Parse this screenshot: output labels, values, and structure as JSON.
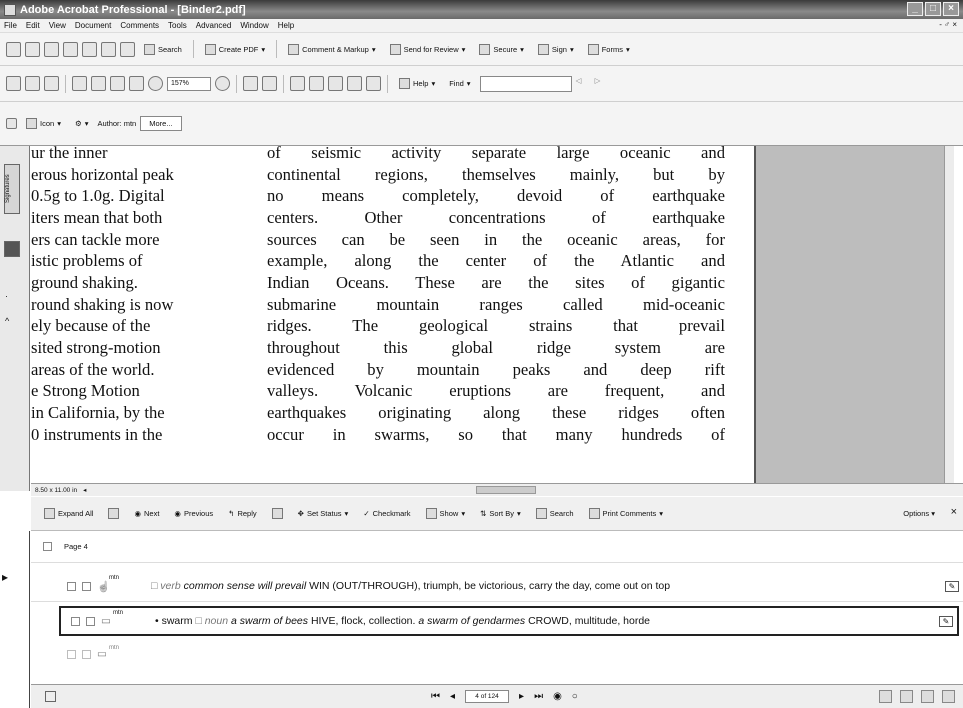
{
  "window": {
    "title": "Adobe Acrobat Professional - [Binder2.pdf]"
  },
  "menu": [
    "File",
    "Edit",
    "View",
    "Document",
    "Comments",
    "Tools",
    "Advanced",
    "Window",
    "Help"
  ],
  "toolbar1": {
    "search": "Search",
    "create_pdf": "Create PDF",
    "comment_markup": "Comment & Markup",
    "send_review": "Send for Review",
    "secure": "Secure",
    "sign": "Sign",
    "forms": "Forms"
  },
  "toolbar2": {
    "zoom": "157%",
    "help": "Help",
    "find": "Find"
  },
  "toolbar3": {
    "icon_label": "Icon",
    "author_label": "Author: mtn",
    "more": "More..."
  },
  "left_tabs": {
    "signatures": "Signatures"
  },
  "document": {
    "col1": [
      "ur      the     inner",
      "erous horizontal peak",
      "0.5g to 1.0g. Digital",
      "iters mean that both",
      "ers can tackle more",
      "istic   problems   of",
      "ground shaking.",
      "round shaking is now",
      "ely  because  of  the",
      "sited  strong-motion",
      "areas of the world.",
      "e    Strong    Motion",
      "in California, by the",
      "0 instruments in the"
    ],
    "col2": [
      "of seismic activity separate large oceanic and",
      "continental regions, themselves mainly, but by",
      "no means completely, devoid of earthquake",
      "centers. Other concentrations of earthquake",
      "sources can be seen in the oceanic areas, for",
      "example, along the center of the Atlantic and",
      "Indian Oceans. These are the sites of gigantic",
      "submarine mountain ranges called mid-oceanic",
      "ridges. The geological strains that prevail",
      "throughout this global ridge system are",
      "evidenced by mountain peaks and deep rift",
      "valleys. Volcanic eruptions are frequent, and",
      "earthquakes originating along these ridges often",
      "occur in swarms, so that many hundreds of"
    ]
  },
  "page_size": "8.50 x 11.00 in",
  "comments_toolbar": {
    "expand_all": "Expand All",
    "next": "Next",
    "previous": "Previous",
    "reply": "Reply",
    "set_status": "Set Status",
    "checkmark": "Checkmark",
    "show": "Show",
    "sort_by": "Sort By",
    "search": "Search",
    "print": "Print Comments",
    "options": "Options",
    "close": "×"
  },
  "comments": {
    "page_header": "Page 4",
    "rows": [
      {
        "author": "mtn",
        "lead": "",
        "pos": "verb",
        "example": "common sense will prevail",
        "body": "WIN (OUT/THROUGH), triumph, be victorious, carry the day, come out on top"
      },
      {
        "author": "mtn",
        "lead": "• swarm",
        "pos": "noun",
        "example": "a swarm of bees",
        "body": "HIVE, flock, collection.",
        "example2": "a swarm of gendarmes",
        "body2": "CROWD, multitude, horde"
      },
      {
        "author": "mtn"
      }
    ]
  },
  "status": {
    "page": "4 of 124"
  }
}
